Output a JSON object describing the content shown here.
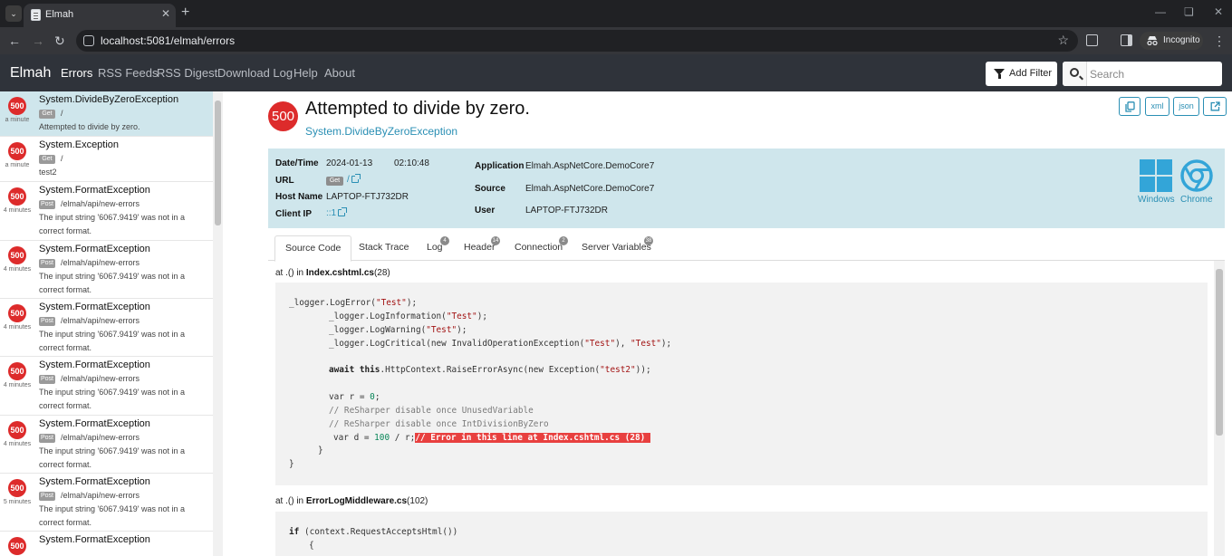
{
  "browser": {
    "tab_title": "Elmah",
    "url": "localhost:5081/elmah/errors",
    "incognito_label": "Incognito"
  },
  "navbar": {
    "brand": "Elmah",
    "links": [
      "Errors",
      "RSS Feeds",
      "RSS Digest",
      "Download Log",
      "Help",
      "About"
    ],
    "filter_label": "Add Filter",
    "search_placeholder": "Search"
  },
  "sidebar": {
    "items": [
      {
        "code": "500",
        "time": "a minute",
        "type": "System.DivideByZeroException",
        "verb": "Get",
        "path": "/",
        "message": "Attempted to divide by zero."
      },
      {
        "code": "500",
        "time": "a minute",
        "type": "System.Exception",
        "verb": "Get",
        "path": "/",
        "message": "test2"
      },
      {
        "code": "500",
        "time": "4 minutes",
        "type": "System.FormatException",
        "verb": "Post",
        "path": "/elmah/api/new-errors",
        "message": "The input string '6067.9419' was not in a correct format."
      },
      {
        "code": "500",
        "time": "4 minutes",
        "type": "System.FormatException",
        "verb": "Post",
        "path": "/elmah/api/new-errors",
        "message": "The input string '6067.9419' was not in a correct format."
      },
      {
        "code": "500",
        "time": "4 minutes",
        "type": "System.FormatException",
        "verb": "Post",
        "path": "/elmah/api/new-errors",
        "message": "The input string '6067.9419' was not in a correct format."
      },
      {
        "code": "500",
        "time": "4 minutes",
        "type": "System.FormatException",
        "verb": "Post",
        "path": "/elmah/api/new-errors",
        "message": "The input string '6067.9419' was not in a correct format."
      },
      {
        "code": "500",
        "time": "4 minutes",
        "type": "System.FormatException",
        "verb": "Post",
        "path": "/elmah/api/new-errors",
        "message": "The input string '6067.9419' was not in a correct format."
      },
      {
        "code": "500",
        "time": "5 minutes",
        "type": "System.FormatException",
        "verb": "Post",
        "path": "/elmah/api/new-errors",
        "message": "The input string '6067.9419' was not in a correct format."
      },
      {
        "code": "500",
        "time": "",
        "type": "System.FormatException",
        "verb": "",
        "path": "",
        "message": ""
      }
    ]
  },
  "detail": {
    "status_code": "500",
    "title": "Attempted to divide by zero.",
    "type": "System.DivideByZeroException",
    "actions": [
      "xml",
      "json"
    ],
    "info": {
      "date_label": "Date/Time",
      "date": "2024-01-13",
      "time": "02:10:48",
      "url_label": "URL",
      "url_verb": "Get",
      "url_path": "/",
      "host_label": "Host Name",
      "host": "LAPTOP-FTJ732DR",
      "ip_label": "Client IP",
      "ip": "::1",
      "app_label": "Application",
      "app": "Elmah.AspNetCore.DemoCore7",
      "source_label": "Source",
      "source": "Elmah.AspNetCore.DemoCore7",
      "user_label": "User",
      "user": "LAPTOP-FTJ732DR",
      "os_label": "Windows",
      "browser_label": "Chrome"
    },
    "tabs": [
      {
        "label": "Source Code",
        "count": ""
      },
      {
        "label": "Stack Trace",
        "count": ""
      },
      {
        "label": "Log",
        "count": "4"
      },
      {
        "label": "Header",
        "count": "14"
      },
      {
        "label": "Connection",
        "count": "2"
      },
      {
        "label": "Server Variables",
        "count": "38"
      }
    ],
    "frames": [
      {
        "prefix": "at .() in ",
        "file": "Index.cshtml.cs",
        "line": "(28)"
      },
      {
        "prefix": "at .() in ",
        "file": "ErrorLogMiddleware.cs",
        "line": "(102)"
      }
    ],
    "highlight_comment": "// Error in this line at Index.cshtml.cs (28) "
  },
  "colors": {
    "accent": "#2a8fb4",
    "danger": "#dd2b2b",
    "navbar": "#2f333a",
    "info_bg": "#cfe6ec"
  }
}
